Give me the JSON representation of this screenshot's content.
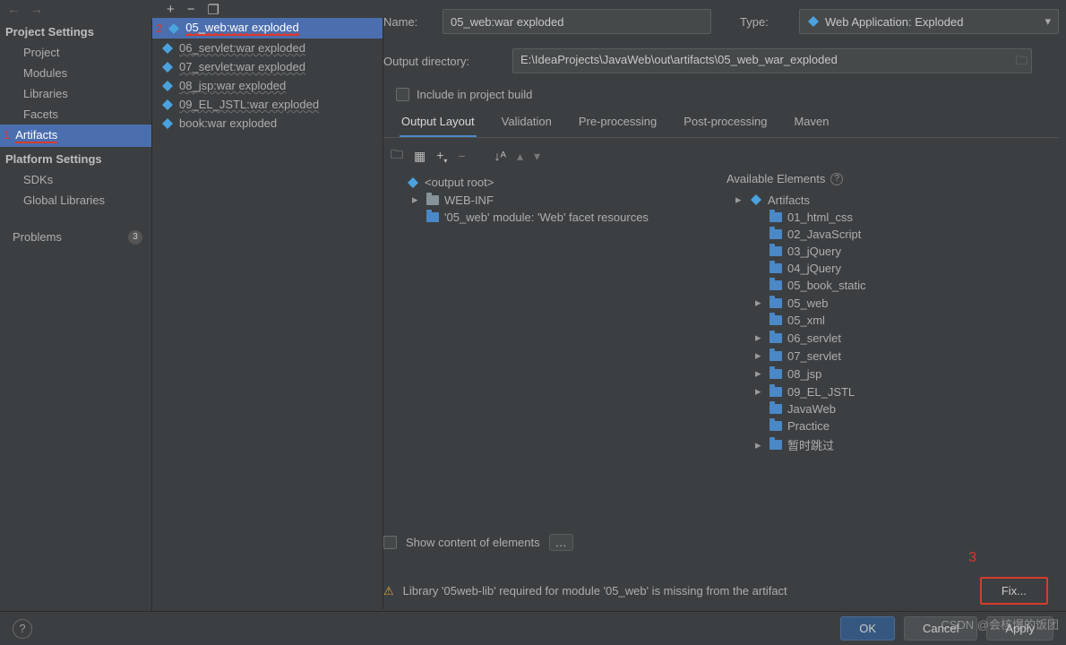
{
  "nav": {
    "back_icon": "←",
    "fwd_icon": "→"
  },
  "artifact_toolbar": {
    "add": "+",
    "remove": "−",
    "copy": "❐"
  },
  "sidebar": {
    "project_settings_hdr": "Project Settings",
    "items_ps": [
      "Project",
      "Modules",
      "Libraries",
      "Facets",
      "Artifacts"
    ],
    "selected_ps_index": 4,
    "platform_settings_hdr": "Platform Settings",
    "items_pf": [
      "SDKs",
      "Global Libraries"
    ],
    "problems_label": "Problems",
    "problems_count": "3",
    "annot_1": "1"
  },
  "artifacts_list": {
    "items": [
      "05_web:war exploded",
      "06_servlet:war exploded",
      "07_servlet:war exploded",
      "08_jsp:war exploded",
      "09_EL_JSTL:war exploded",
      "book:war exploded"
    ],
    "selected_index": 0,
    "annot_2": "2"
  },
  "details": {
    "name_label": "Name:",
    "name_value": "05_web:war exploded",
    "type_label": "Type:",
    "type_value": "Web Application: Exploded",
    "out_label": "Output directory:",
    "out_value": "E:\\IdeaProjects\\JavaWeb\\out\\artifacts\\05_web_war_exploded",
    "include_label": "Include in project build",
    "tabs": [
      "Output Layout",
      "Validation",
      "Pre-processing",
      "Post-processing",
      "Maven"
    ],
    "active_tab": 0
  },
  "output_tree": {
    "root": "<output root>",
    "webinf": "WEB-INF",
    "facet": "'05_web' module: 'Web' facet resources"
  },
  "available": {
    "title": "Available Elements",
    "root": "Artifacts",
    "items": [
      {
        "name": "01_html_css",
        "expandable": false
      },
      {
        "name": "02_JavaScript",
        "expandable": false
      },
      {
        "name": "03_jQuery",
        "expandable": false
      },
      {
        "name": "04_jQuery",
        "expandable": false
      },
      {
        "name": "05_book_static",
        "expandable": false
      },
      {
        "name": "05_web",
        "expandable": true
      },
      {
        "name": "05_xml",
        "expandable": false
      },
      {
        "name": "06_servlet",
        "expandable": true
      },
      {
        "name": "07_servlet",
        "expandable": true
      },
      {
        "name": "08_jsp",
        "expandable": true
      },
      {
        "name": "09_EL_JSTL",
        "expandable": true
      },
      {
        "name": "JavaWeb",
        "expandable": false
      },
      {
        "name": "Practice",
        "expandable": false
      },
      {
        "name": "暂时跳过",
        "expandable": true
      }
    ]
  },
  "show_content_label": "Show content of elements",
  "warning_text": "Library '05web-lib' required for module '05_web' is missing from the artifact",
  "fix_label": "Fix...",
  "annot_3": "3",
  "buttons": {
    "ok": "OK",
    "cancel": "Cancel",
    "apply": "Apply"
  },
  "watermark": "CSDN @会核爆的饭团"
}
